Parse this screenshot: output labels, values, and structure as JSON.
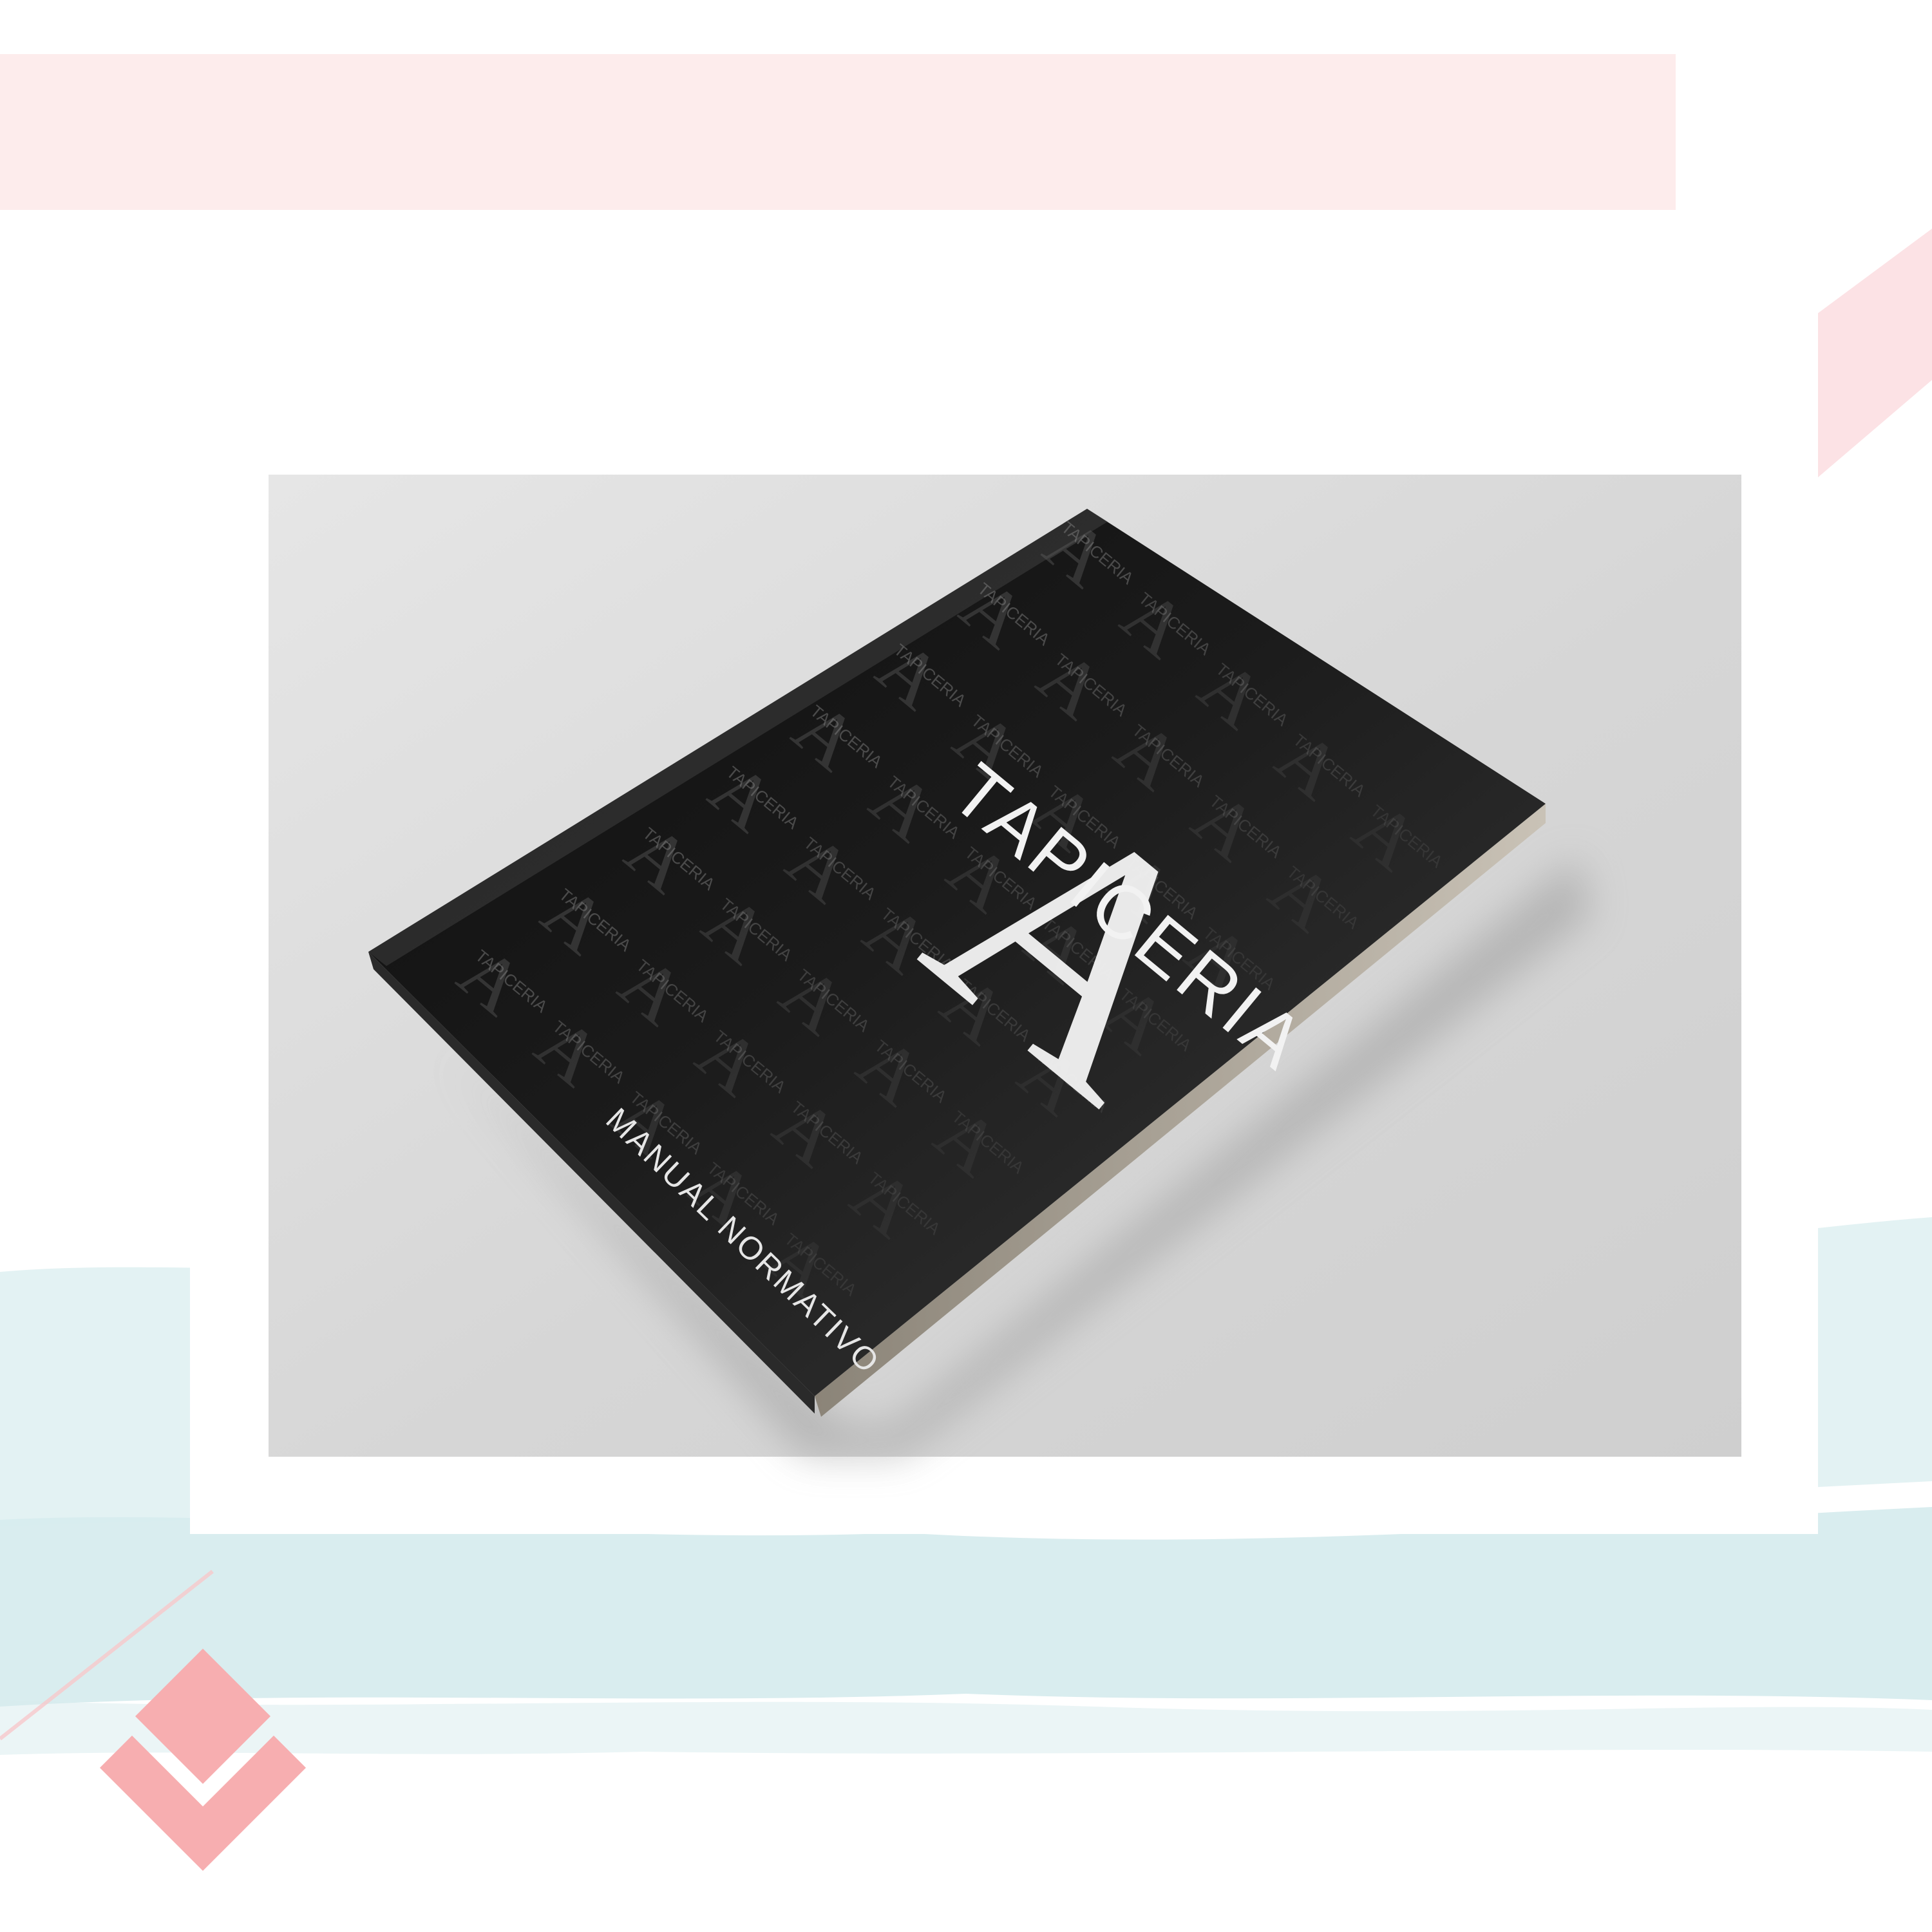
{
  "book": {
    "brand": "TAPICERIA",
    "subtitle": "MANUAL NORMATIVO",
    "pattern_text": "TAPICERIA"
  },
  "colors": {
    "banner_pink": "#FDECEC",
    "accent_pink": "#F7AEB0",
    "brush_blue": "#D7ECEE",
    "cover_black": "#101010",
    "backdrop_grey": "#D2D2D2",
    "logo_white": "#F2F2F2"
  },
  "decor": {
    "corner_icon": "chevron-diamond-icon"
  }
}
